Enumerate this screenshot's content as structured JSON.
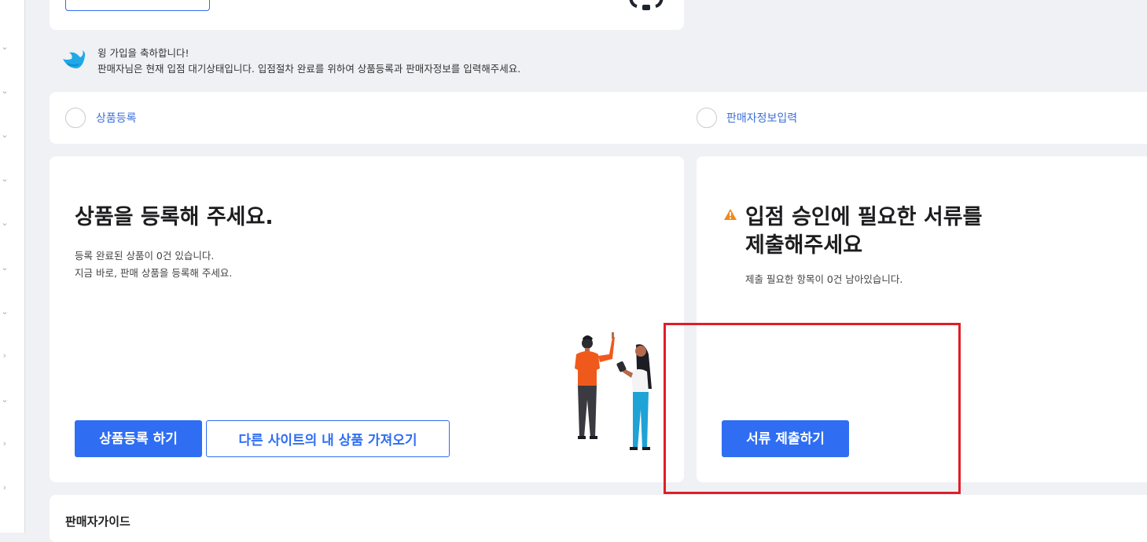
{
  "welcome": {
    "line1": "윙 가입을 축하합니다!",
    "line2": "판매자님은 현재 입점 대기상태입니다. 입점절차 완료를 위하여 상품등록과 판매자정보를 입력해주세요."
  },
  "steps": [
    {
      "label": "상품등록"
    },
    {
      "label": "판매자정보입력"
    }
  ],
  "product_card": {
    "title": "상품을 등록해 주세요.",
    "desc_line1": "등록 완료된 상품이 0건 있습니다.",
    "desc_line2": "지금 바로, 판매 상품을 등록해 주세요.",
    "register_button": "상품등록 하기",
    "import_button": "다른 사이트의 내 상품 가져오기"
  },
  "docs_card": {
    "title_line1": "입점 승인에 필요한 서류를",
    "title_line2": "제출해주세요",
    "desc": "제출 필요한 항목이 0건 남아있습니다.",
    "submit_button": "서류 제출하기"
  },
  "guide": {
    "title": "판매자가이드"
  },
  "colors": {
    "accent": "#2f6ef2",
    "highlight": "#e01e26",
    "warning": "#f08a1c",
    "background": "#f0f1f5"
  },
  "icons": {
    "welcome": "bird-icon",
    "warning": "warning-icon",
    "rail": "chevron-icon"
  }
}
